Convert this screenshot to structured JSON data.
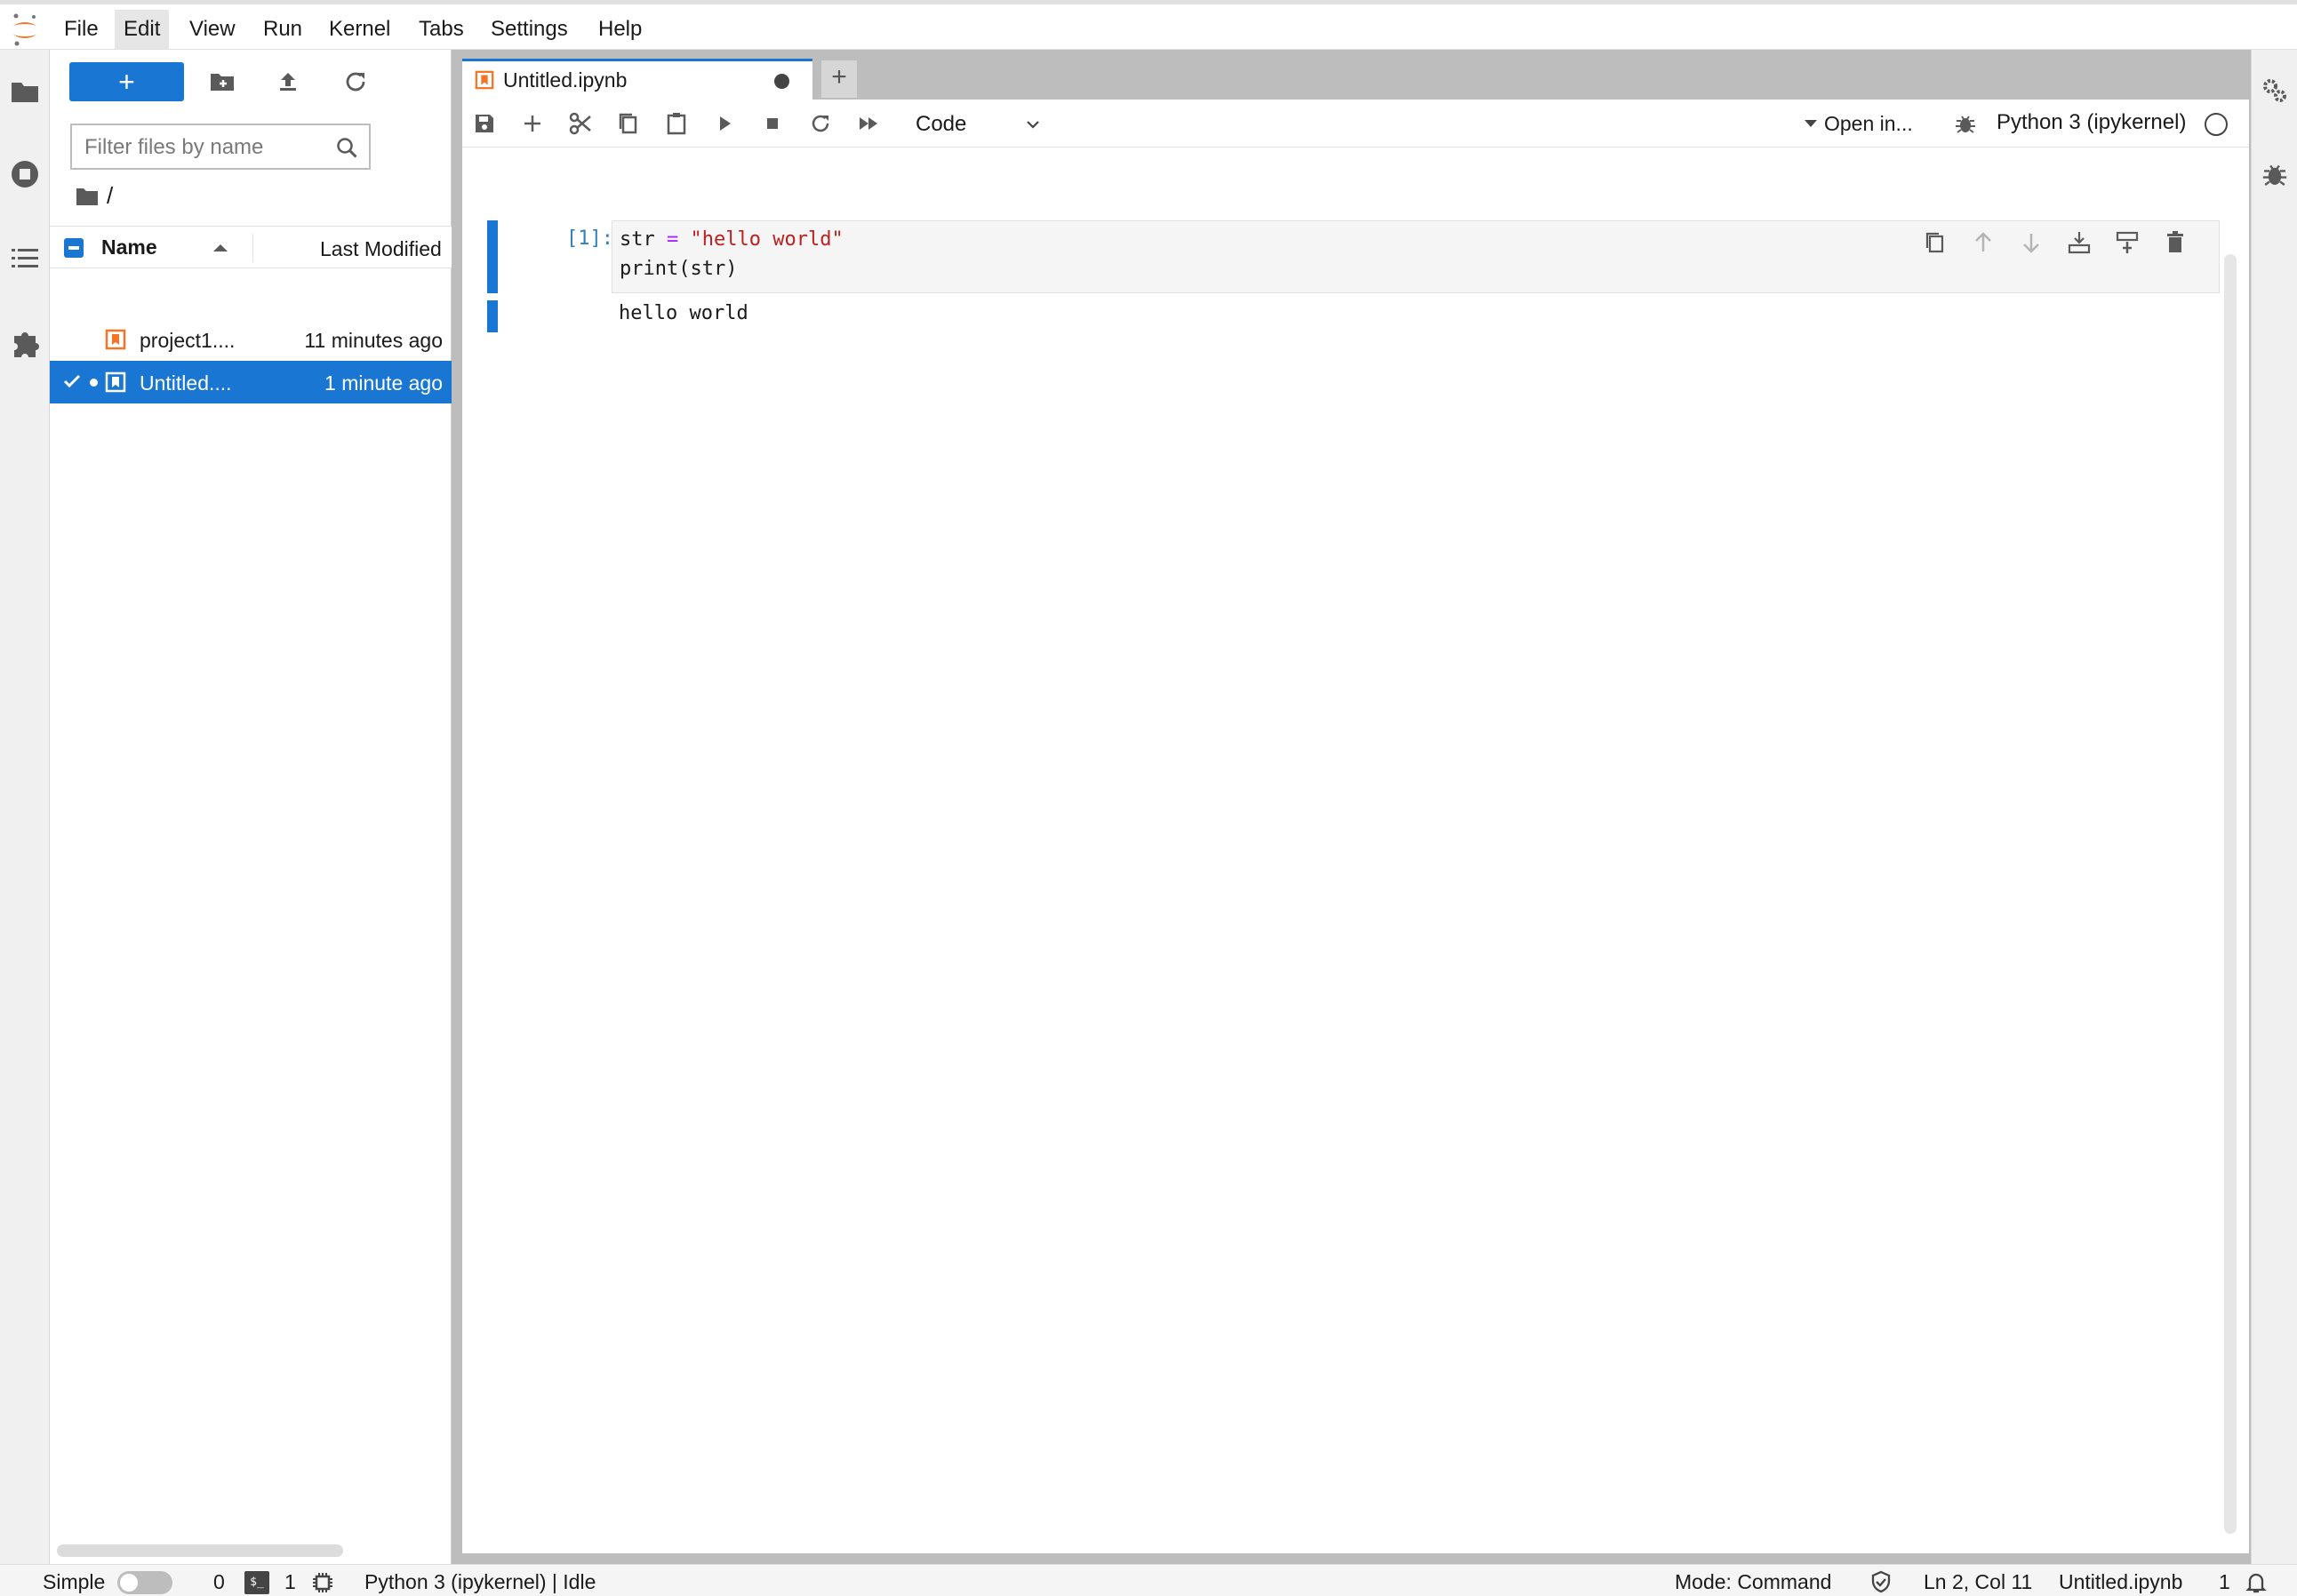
{
  "menu": {
    "items": [
      {
        "label": "File"
      },
      {
        "label": "Edit"
      },
      {
        "label": "View"
      },
      {
        "label": "Run"
      },
      {
        "label": "Kernel"
      },
      {
        "label": "Tabs"
      },
      {
        "label": "Settings"
      },
      {
        "label": "Help"
      }
    ]
  },
  "file_browser": {
    "new_button_label": "+",
    "filter_placeholder": "Filter files by name",
    "breadcrumb": "/",
    "columns": {
      "name": "Name",
      "modified": "Last Modified"
    },
    "files": [
      {
        "name": "project1....",
        "modified": "11 minutes ago",
        "selected": false
      },
      {
        "name": "Untitled....",
        "modified": "1 minute ago",
        "selected": true
      }
    ]
  },
  "notebook": {
    "tab_title": "Untitled.ipynb",
    "tab_add": "+",
    "cell_type": "Code",
    "open_in": "Open in...",
    "kernel_name": "Python 3 (ipykernel)",
    "cell": {
      "prompt": "[1]:",
      "code_line1": {
        "var": "str",
        "op": "=",
        "str": "\"hello world\""
      },
      "code_line2": "print(str)",
      "output": "hello world"
    }
  },
  "status_bar": {
    "simple_label": "Simple",
    "terminals_count": "0",
    "kernels_count": "1",
    "kernel_status": "Python 3 (ipykernel) | Idle",
    "mode": "Mode: Command",
    "cursor": "Ln 2, Col 11",
    "file": "Untitled.ipynb",
    "notifications": "1"
  },
  "colors": {
    "accent": "#1976d2",
    "notebook_icon": "#f37626",
    "string": "#ba2121",
    "operator": "#aa22ff"
  }
}
